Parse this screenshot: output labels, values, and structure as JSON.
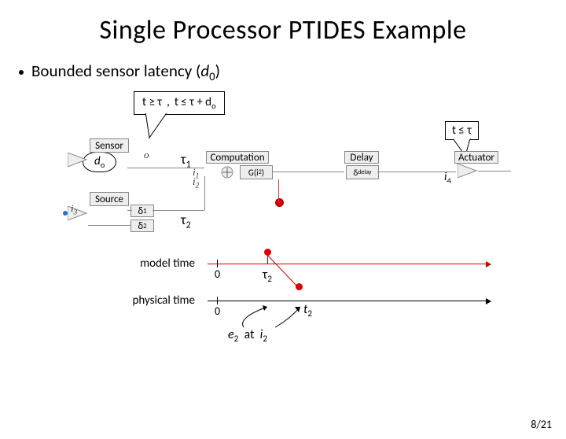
{
  "title": "Single Processor PTIDES Example",
  "bullet": {
    "prefix": "Bounded sensor latency   (",
    "var": "d",
    "sub": "0",
    "suffix": ")"
  },
  "callout1": {
    "a": "t ≥ τ",
    "sep": ",",
    "b": "t ≤ τ + d",
    "bsub": "o"
  },
  "callout2": "t ≤ τ",
  "d_o": {
    "d": "d",
    "sub": "o"
  },
  "tau1": "τ",
  "tau1sub": "1",
  "tau2": "τ",
  "tau2sub": "2",
  "i4": {
    "i": "i",
    "sub": "4"
  },
  "blocks": {
    "sensor": "Sensor",
    "comp": "Computation",
    "delay": "Delay",
    "act": "Actuator",
    "source": "Source",
    "i1": {
      "i": "i",
      "sub": "1"
    },
    "i2": {
      "i": "i",
      "sub": "2"
    },
    "i3": {
      "i": "i",
      "sub": "3"
    },
    "o1": "o",
    "d1": {
      "d": "δ",
      "sub": "1"
    },
    "d2": {
      "d": "δ",
      "sub": "2"
    },
    "g": {
      "pre": "G(",
      "i": "i",
      "sub": "2",
      "post": ")"
    },
    "ddelay": {
      "d": "δ",
      "sub": "delay"
    }
  },
  "timelines": {
    "model": "model time",
    "physical": "physical time",
    "zero": "0",
    "tau2lab": "τ",
    "tau2labsub": "2",
    "t2": {
      "t": "t",
      "sub": "2"
    }
  },
  "bottom": {
    "e": "e",
    "esub": "2",
    "mid": "at",
    "i": "i",
    "isub": "2"
  },
  "page": "8/21"
}
